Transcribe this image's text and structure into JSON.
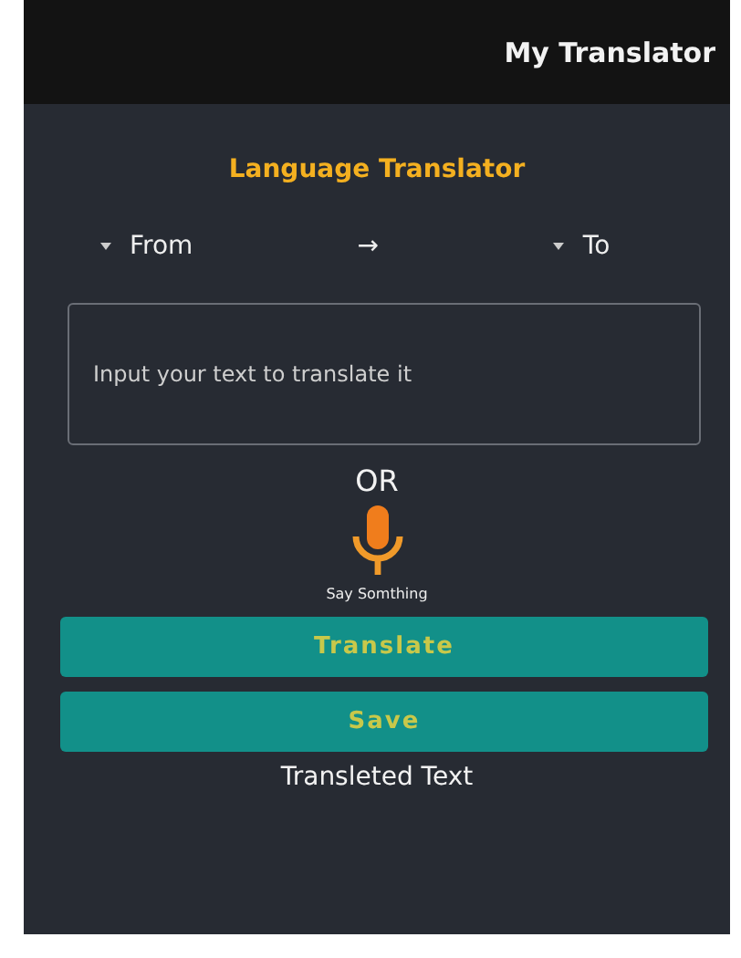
{
  "app_bar": {
    "title": "My Translator"
  },
  "heading": "Language Translator",
  "languages": {
    "from": "From",
    "arrow": "→",
    "to": "To"
  },
  "input": {
    "placeholder": "Input your text to translate it"
  },
  "or_label": "OR",
  "voice": {
    "caption": "Say Somthing"
  },
  "buttons": [
    {
      "label": "Translate"
    },
    {
      "label": "Save"
    }
  ],
  "output_label": "Transleted Text"
}
